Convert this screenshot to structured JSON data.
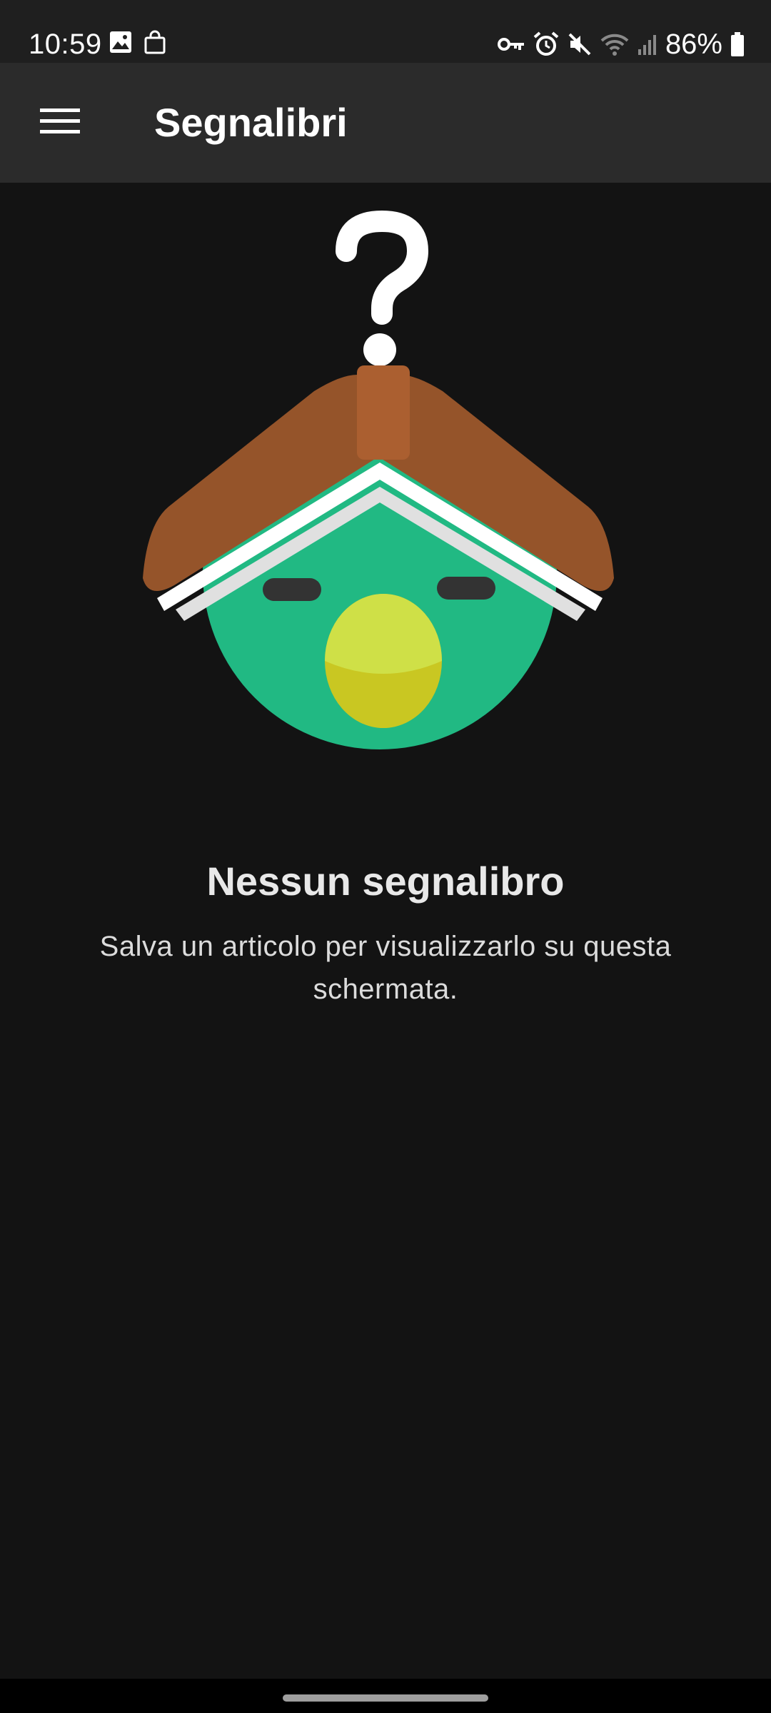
{
  "status_bar": {
    "time": "10:59",
    "battery": "86%",
    "left_icons": [
      "image-icon",
      "shopping-bag-icon"
    ],
    "right_icons": [
      "vpn-key-icon",
      "alarm-icon",
      "mute-icon",
      "wifi-icon",
      "signal-icon",
      "battery-icon"
    ]
  },
  "app_bar": {
    "title": "Segnalibri",
    "menu_icon": "hamburger-menu-icon"
  },
  "empty_state": {
    "illustration": "bird-with-book-and-question-mark",
    "title": "Nessun segnalibro",
    "description": "Salva un articolo per visualizzarlo su questa schermata."
  },
  "colors": {
    "background": "#131313",
    "app_bar": "#2b2b2b",
    "status_bar": "#1f1f1f",
    "bird_green": "#21b983",
    "book_brown": "#95542a",
    "beak_yellow": "#cfe047"
  }
}
